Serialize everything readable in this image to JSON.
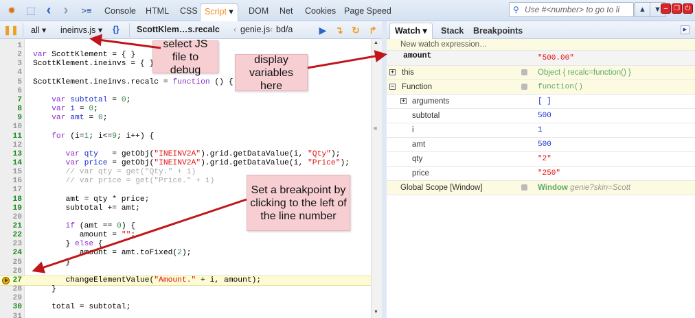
{
  "topbar": {
    "tabs": [
      "Console",
      "HTML",
      "CSS",
      "Script",
      "DOM",
      "Net",
      "Cookies",
      "Page Speed"
    ],
    "active_tab": "Script",
    "search_placeholder": "Use #<number> to go to li"
  },
  "toolbar": {
    "filter": "all",
    "file": "ineinvs.js",
    "pretty_print": "{}",
    "breadcrumbs": [
      "ScottKlem…s.recalc",
      "genie.js",
      "bd/a"
    ]
  },
  "code": {
    "lines": [
      {
        "n": 1,
        "ex": false,
        "t": []
      },
      {
        "n": 2,
        "ex": false,
        "t": [
          [
            "k",
            "var"
          ],
          [
            "n",
            " ScottKlement = { }"
          ]
        ]
      },
      {
        "n": 3,
        "ex": false,
        "t": [
          [
            "n",
            "ScottKlement.ineinvs = { }"
          ]
        ]
      },
      {
        "n": 4,
        "ex": false,
        "t": []
      },
      {
        "n": 5,
        "ex": false,
        "t": [
          [
            "n",
            "ScottKlement.ineinvs.recalc = "
          ],
          [
            "k",
            "function"
          ],
          [
            "n",
            " () {"
          ]
        ]
      },
      {
        "n": 6,
        "ex": false,
        "t": []
      },
      {
        "n": 7,
        "ex": true,
        "t": [
          [
            "n",
            "    "
          ],
          [
            "k",
            "var"
          ],
          [
            "v",
            " subtotal"
          ],
          [
            "n",
            " = "
          ],
          [
            "num",
            "0"
          ],
          [
            "n",
            ";"
          ]
        ]
      },
      {
        "n": 8,
        "ex": true,
        "t": [
          [
            "n",
            "    "
          ],
          [
            "k",
            "var"
          ],
          [
            "v",
            " i"
          ],
          [
            "n",
            " = "
          ],
          [
            "num",
            "0"
          ],
          [
            "n",
            ";"
          ]
        ]
      },
      {
        "n": 9,
        "ex": true,
        "t": [
          [
            "n",
            "    "
          ],
          [
            "k",
            "var"
          ],
          [
            "v",
            " amt"
          ],
          [
            "n",
            " = "
          ],
          [
            "num",
            "0"
          ],
          [
            "n",
            ";"
          ]
        ]
      },
      {
        "n": 10,
        "ex": false,
        "t": []
      },
      {
        "n": 11,
        "ex": true,
        "t": [
          [
            "n",
            "    "
          ],
          [
            "k",
            "for"
          ],
          [
            "n",
            " (i="
          ],
          [
            "num",
            "1"
          ],
          [
            "n",
            "; i<="
          ],
          [
            "num",
            "9"
          ],
          [
            "n",
            "; i++) {"
          ]
        ]
      },
      {
        "n": 12,
        "ex": false,
        "t": []
      },
      {
        "n": 13,
        "ex": true,
        "t": [
          [
            "n",
            "       "
          ],
          [
            "k",
            "var"
          ],
          [
            "v",
            " qty"
          ],
          [
            "n",
            "   = getObj("
          ],
          [
            "s",
            "\"INEINV2A\""
          ],
          [
            "n",
            ").grid.getDataValue(i, "
          ],
          [
            "s",
            "\"Qty\""
          ],
          [
            "n",
            ");"
          ]
        ]
      },
      {
        "n": 14,
        "ex": true,
        "t": [
          [
            "n",
            "       "
          ],
          [
            "k",
            "var"
          ],
          [
            "v",
            " price"
          ],
          [
            "n",
            " = getObj("
          ],
          [
            "s",
            "\"INEINV2A\""
          ],
          [
            "n",
            ").grid.getDataValue(i, "
          ],
          [
            "s",
            "\"Price\""
          ],
          [
            "n",
            ");"
          ]
        ]
      },
      {
        "n": 15,
        "ex": false,
        "t": [
          [
            "c",
            "       // var qty = get(\"Qty.\" + i)"
          ]
        ]
      },
      {
        "n": 16,
        "ex": false,
        "t": [
          [
            "c",
            "       // var price = get(\"Price.\" + i)"
          ]
        ]
      },
      {
        "n": 17,
        "ex": false,
        "t": []
      },
      {
        "n": 18,
        "ex": true,
        "t": [
          [
            "n",
            "       amt = qty * price;"
          ]
        ]
      },
      {
        "n": 19,
        "ex": true,
        "t": [
          [
            "n",
            "       subtotal += amt;"
          ]
        ]
      },
      {
        "n": 20,
        "ex": false,
        "t": []
      },
      {
        "n": 21,
        "ex": true,
        "t": [
          [
            "n",
            "       "
          ],
          [
            "k",
            "if"
          ],
          [
            "n",
            " (amt == "
          ],
          [
            "num",
            "0"
          ],
          [
            "n",
            ") {"
          ]
        ]
      },
      {
        "n": 22,
        "ex": true,
        "t": [
          [
            "n",
            "          amount = "
          ],
          [
            "s",
            "\"\""
          ],
          [
            "n",
            ";"
          ]
        ]
      },
      {
        "n": 23,
        "ex": false,
        "t": [
          [
            "n",
            "       } "
          ],
          [
            "k",
            "else"
          ],
          [
            "n",
            " {"
          ]
        ]
      },
      {
        "n": 24,
        "ex": true,
        "t": [
          [
            "n",
            "          amount = amt.toFixed("
          ],
          [
            "num",
            "2"
          ],
          [
            "n",
            ");"
          ]
        ]
      },
      {
        "n": 25,
        "ex": false,
        "t": [
          [
            "n",
            "       }"
          ]
        ]
      },
      {
        "n": 26,
        "ex": false,
        "t": []
      },
      {
        "n": 27,
        "ex": true,
        "cur": true,
        "t": [
          [
            "n",
            "       changeElementValue("
          ],
          [
            "s",
            "\"Amount.\""
          ],
          [
            "n",
            " + i, amount);"
          ]
        ]
      },
      {
        "n": 28,
        "ex": false,
        "t": [
          [
            "n",
            "    }"
          ]
        ]
      },
      {
        "n": 29,
        "ex": false,
        "t": []
      },
      {
        "n": 30,
        "ex": true,
        "t": [
          [
            "n",
            "    total = subtotal;"
          ]
        ]
      },
      {
        "n": 31,
        "ex": false,
        "t": []
      }
    ]
  },
  "right_panel": {
    "tabs": [
      "Watch",
      "Stack",
      "Breakpoints"
    ],
    "active_tab": "Watch",
    "new_watch": "New watch expression…",
    "watch": {
      "name": "amount",
      "value": "\"500.00\""
    },
    "this": {
      "name": "this",
      "value_type": "Object",
      "value_rest": "{  recalc=function() }"
    },
    "function": {
      "name": "Function",
      "value": "function()"
    },
    "vars": [
      {
        "name": "arguments",
        "value": "[ ]",
        "kind": "obj",
        "expandable": true
      },
      {
        "name": "subtotal",
        "value": "500",
        "kind": "num"
      },
      {
        "name": "i",
        "value": "1",
        "kind": "num"
      },
      {
        "name": "amt",
        "value": "500",
        "kind": "num"
      },
      {
        "name": "qty",
        "value": "\"2\"",
        "kind": "str"
      },
      {
        "name": "price",
        "value": "\"250\"",
        "kind": "str"
      }
    ],
    "global": {
      "name": "Global Scope [Window]",
      "value_type": "Window",
      "value_rest": "genie?skin=Scott"
    }
  },
  "callouts": {
    "select_file": "select JS file to debug",
    "display_vars": "display variables here",
    "breakpoint": "Set a breakpoint by clicking to the left of the line number"
  },
  "colors": {
    "accent": "#f08a1c",
    "callout": "#f7cfd3",
    "arrow": "#c0161b",
    "executable_line": "#1d8a1d",
    "string": "#e01010",
    "keyword": "#8b2fd1"
  }
}
